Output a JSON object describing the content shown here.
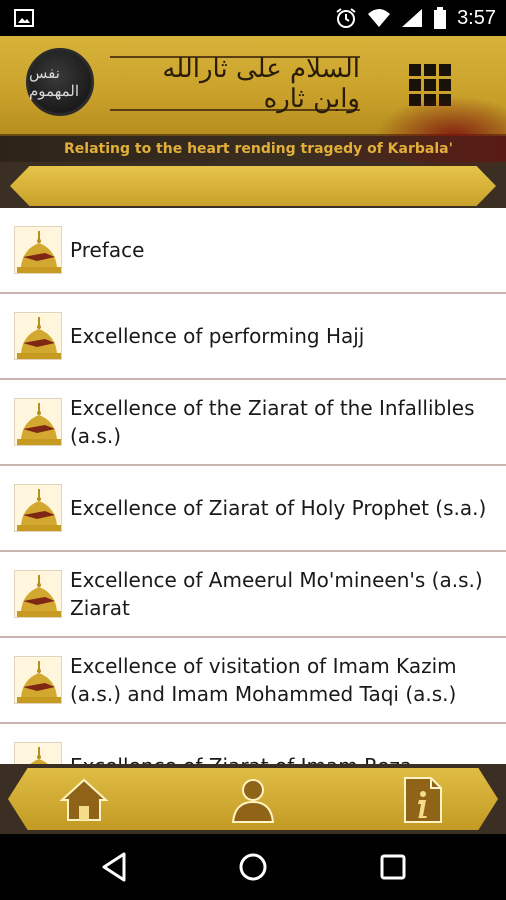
{
  "status_bar": {
    "time": "3:57",
    "icons": [
      "image-icon",
      "alarm-icon",
      "wifi-icon",
      "signal-icon",
      "battery-icon"
    ]
  },
  "header": {
    "logo_text": "نفس المهموم",
    "calligraphy_text": "السلام علی ثارالله وابن ثاره",
    "tagline": "Relating to the heart rending tragedy of Karbala'",
    "menu_icon": "grid-menu-icon",
    "colors": {
      "gold": "#c9a12a",
      "dark": "#3a2f22",
      "tagline": "#e2b03a"
    }
  },
  "list": {
    "items": [
      {
        "label": "Preface"
      },
      {
        "label": "Excellence of performing Hajj"
      },
      {
        "label": "Excellence of the Ziarat of the Infallibles (a.s.)"
      },
      {
        "label": "Excellence of Ziarat of Holy Prophet (s.a.)"
      },
      {
        "label": "Excellence of Ameerul Mo'mineen's (a.s.) Ziarat"
      },
      {
        "label": "Excellence of visitation of Imam Kazim (a.s.) and Imam Mohammed Taqi (a.s.)"
      },
      {
        "label": "Excellence of Ziarat of Imam Reza"
      }
    ],
    "item_icon": "dome-icon"
  },
  "bottom_nav": {
    "items": [
      {
        "icon": "home-icon"
      },
      {
        "icon": "user-icon"
      },
      {
        "icon": "info-document-icon"
      }
    ]
  },
  "system_nav": {
    "items": [
      {
        "icon": "back-icon"
      },
      {
        "icon": "home-circle-icon"
      },
      {
        "icon": "recents-icon"
      }
    ]
  }
}
